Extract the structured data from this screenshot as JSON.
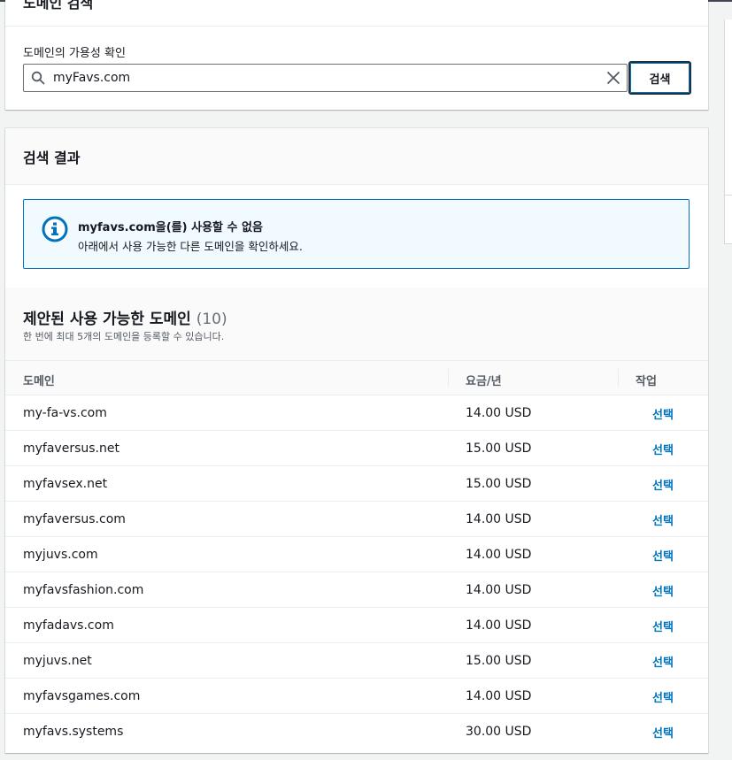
{
  "search_card": {
    "title": "도메인 검색",
    "availability_label": "도메인의 가용성 확인",
    "search_value": "myFavs.com",
    "search_button": "검색"
  },
  "results_card": {
    "title": "검색 결과",
    "alert": {
      "title": "myfavs.com을(를) 사용할 수 없음",
      "message": "아래에서 사용 가능한 다른 도메인을 확인하세요."
    },
    "suggested": {
      "title": "제안된 사용 가능한 도메인",
      "count": "(10)",
      "description": "한 번에 최대 5개의 도메인을 등록할 수 있습니다."
    },
    "columns": [
      "도메인",
      "요금/년",
      "작업"
    ],
    "rows": [
      {
        "domain": "my-fa-vs.com",
        "price": "14.00 USD",
        "action": "선택"
      },
      {
        "domain": "myfaversus.net",
        "price": "15.00 USD",
        "action": "선택"
      },
      {
        "domain": "myfavsex.net",
        "price": "15.00 USD",
        "action": "선택"
      },
      {
        "domain": "myfaversus.com",
        "price": "14.00 USD",
        "action": "선택"
      },
      {
        "domain": "myjuvs.com",
        "price": "14.00 USD",
        "action": "선택"
      },
      {
        "domain": "myfavsfashion.com",
        "price": "14.00 USD",
        "action": "선택"
      },
      {
        "domain": "myfadavs.com",
        "price": "14.00 USD",
        "action": "선택"
      },
      {
        "domain": "myjuvs.net",
        "price": "15.00 USD",
        "action": "선택"
      },
      {
        "domain": "myfavsgames.com",
        "price": "14.00 USD",
        "action": "선택"
      },
      {
        "domain": "myfavs.systems",
        "price": "30.00 USD",
        "action": "선택"
      }
    ]
  },
  "colors": {
    "link": "#0073bb",
    "info_bg": "#f1faff",
    "info_border": "#0073bb",
    "page_bg": "#f2f3f3"
  },
  "icons": {
    "search": "search-icon",
    "clear": "close-icon",
    "info": "info-icon"
  }
}
